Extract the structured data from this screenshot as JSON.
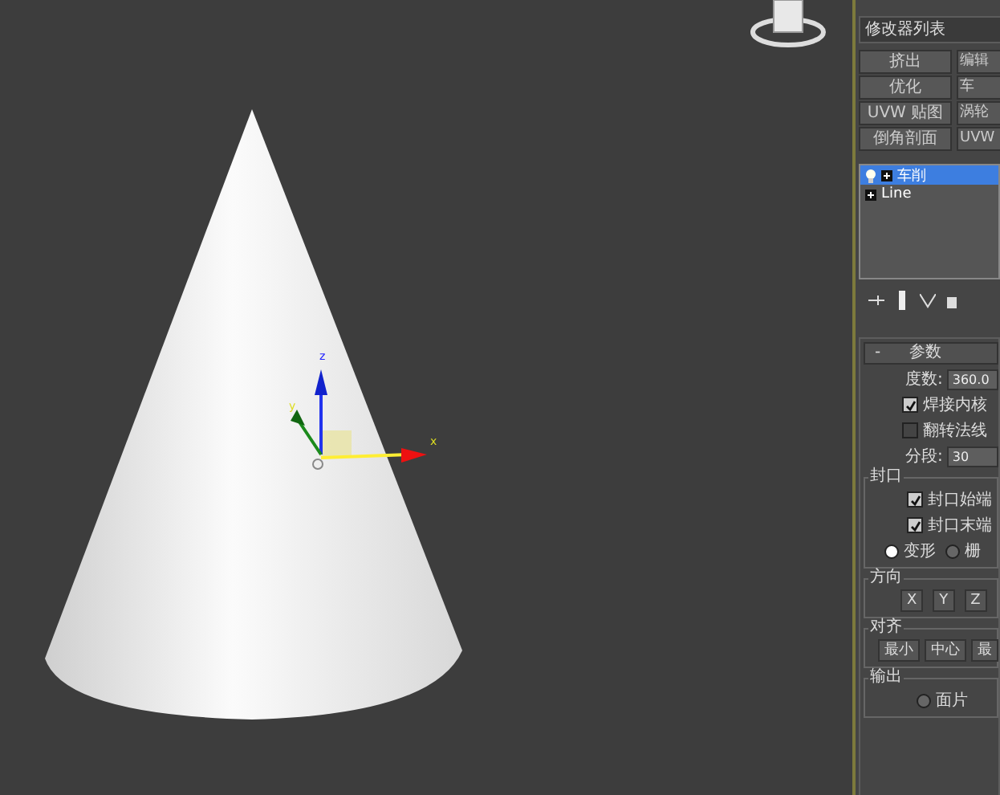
{
  "viewport": {
    "gizmo_axes": [
      "z",
      "y",
      "x"
    ]
  },
  "modifier_list": {
    "label": "修改器列表"
  },
  "modifier_buttons": [
    "挤出",
    "编辑",
    "优化",
    "车",
    "UVW 贴图",
    "涡轮",
    "倒角剖面",
    "UVW"
  ],
  "stack": [
    {
      "label": "车削",
      "selected": true,
      "kind": "modifier"
    },
    {
      "label": "Line",
      "selected": false,
      "kind": "object"
    }
  ],
  "parameters": {
    "title": "参数",
    "collapse": "-",
    "degrees": {
      "label": "度数:",
      "value": "360.0"
    },
    "weld_core": {
      "label": "焊接内核",
      "checked": true
    },
    "flip_normals": {
      "label": "翻转法线",
      "checked": false
    },
    "segments": {
      "label": "分段:",
      "value": "30"
    },
    "capping": {
      "title": "封口",
      "checks": [
        {
          "label": "封口始端",
          "checked": true
        },
        {
          "label": "封口末端",
          "checked": true
        }
      ],
      "options": [
        {
          "label": "变形",
          "selected": true
        },
        {
          "label": "栅",
          "selected": false
        }
      ]
    },
    "direction": {
      "title": "方向",
      "buttons": [
        "X",
        "Y",
        "Z"
      ]
    },
    "align": {
      "title": "对齐",
      "buttons": [
        "最小",
        "中心",
        "最"
      ]
    },
    "output": {
      "title": "输出",
      "options": [
        {
          "label": "面片",
          "selected": false
        }
      ]
    }
  }
}
